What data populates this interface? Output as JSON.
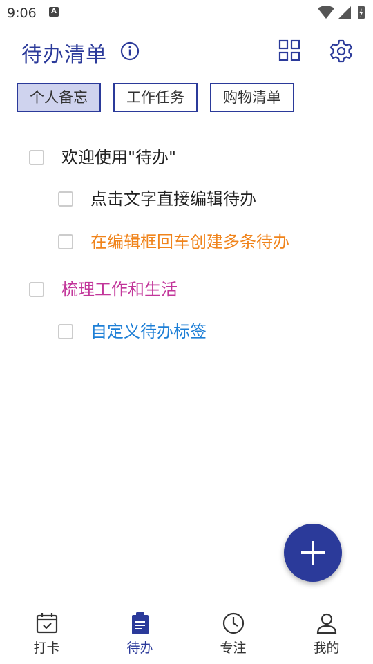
{
  "status_bar": {
    "time": "9:06",
    "notification_glyph": "A"
  },
  "header": {
    "title": "待办清单",
    "icons": [
      "info-icon",
      "grid-view-icon",
      "settings-gear-icon"
    ]
  },
  "tags": [
    {
      "label": "个人备忘",
      "active": true
    },
    {
      "label": "工作任务",
      "active": false
    },
    {
      "label": "购物清单",
      "active": false
    }
  ],
  "todos": [
    {
      "text": "欢迎使用\"待办\"",
      "level": 0,
      "color": "#222222",
      "checked": false
    },
    {
      "text": "点击文字直接编辑待办",
      "level": 1,
      "color": "#222222",
      "checked": false
    },
    {
      "text": "在编辑框回车创建多条待办",
      "level": 1,
      "color": "#f0841c",
      "checked": false
    },
    {
      "text": "梳理工作和生活",
      "level": 0,
      "color": "#c2369a",
      "checked": false
    },
    {
      "text": "自定义待办标签",
      "level": 1,
      "color": "#1e7fd6",
      "checked": false
    }
  ],
  "fab": {
    "icon": "plus-icon"
  },
  "bottom_nav": [
    {
      "label": "打卡",
      "icon": "calendar-check-icon",
      "active": false
    },
    {
      "label": "待办",
      "icon": "clipboard-icon",
      "active": true
    },
    {
      "label": "专注",
      "icon": "clock-icon",
      "active": false
    },
    {
      "label": "我的",
      "icon": "person-icon",
      "active": false
    }
  ],
  "colors": {
    "primary": "#2b3a9a",
    "active_tag_bg": "#cfd3ee"
  }
}
